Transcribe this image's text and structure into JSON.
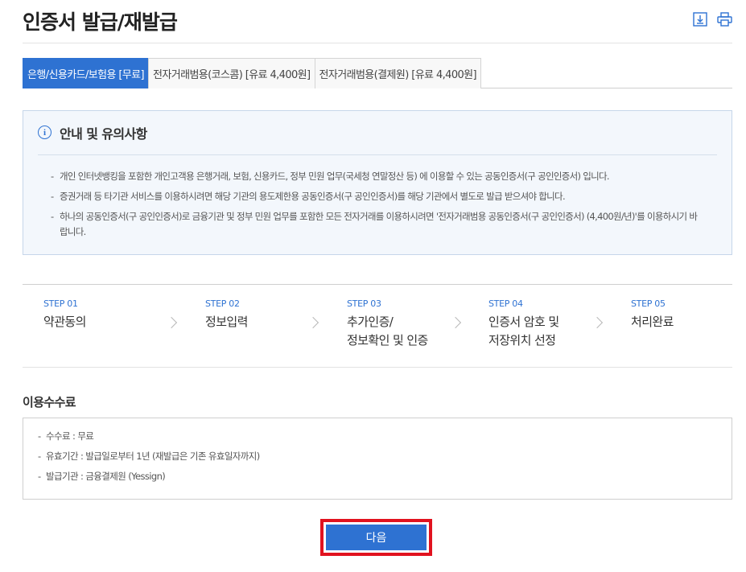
{
  "header": {
    "title": "인증서 발급/재발급",
    "icons": [
      "download-icon",
      "print-icon"
    ]
  },
  "tabs": [
    {
      "label": "은행/신용카드/보험용 [무료]",
      "active": true
    },
    {
      "label": "전자거래범용(코스콤) [유료 4,400원]",
      "active": false
    },
    {
      "label": "전자거래범용(결제원) [유료 4,400원]",
      "active": false
    }
  ],
  "notice": {
    "title": "안내 및 유의사항",
    "items": [
      "개인 인터넷뱅킹을 포함한 개인고객용 은행거래, 보험, 신용카드, 정부 민원 업무(국세청 연말정산 등) 에 이용할 수 있는 공동인증서(구 공인인증서) 입니다.",
      "증권거래 등 타기관 서비스를 이용하시려면 해당 기관의 용도제한용 공동인증서(구 공인인증서)를 해당 기관에서 별도로 발급 받으셔야 합니다.",
      "하나의 공동인증서(구 공인인증서)로 금융기관 및 정부 민원 업무를 포함한 모든 전자거래를 이용하시려면 '전자거래범용 공동인증서(구 공인인증서) (4,400원/년)'를 이용하시기 바랍니다."
    ]
  },
  "steps": [
    {
      "num": "STEP 01",
      "line1": "약관동의",
      "line2": ""
    },
    {
      "num": "STEP 02",
      "line1": "정보입력",
      "line2": ""
    },
    {
      "num": "STEP 03",
      "line1": "추가인증/",
      "line2": "정보확인 및 인증"
    },
    {
      "num": "STEP 04",
      "line1": "인증서 암호 및",
      "line2": "저장위치 선정"
    },
    {
      "num": "STEP 05",
      "line1": "처리완료",
      "line2": ""
    }
  ],
  "fee": {
    "title": "이용수수료",
    "items": [
      "수수료 : 무료",
      "유효기간 : 발급일로부터 1년 (재발급은 기존 유효일자까지)",
      "발급기관 : 금융결제원 (Yessign)"
    ]
  },
  "next_button": {
    "label": "다음"
  },
  "colors": {
    "accent": "#2e72d2",
    "highlight": "#e1121f",
    "notice_bg": "#f3f7fc"
  }
}
